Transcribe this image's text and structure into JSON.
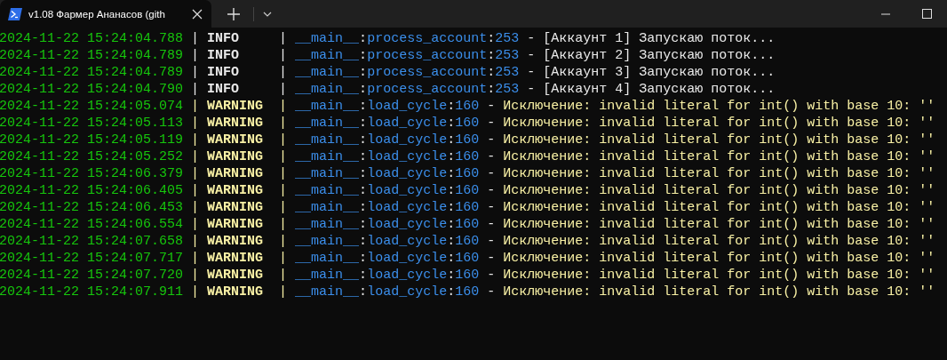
{
  "tabs": [
    {
      "title": "v1.08 Фармер Ананасов (gith",
      "selected": true
    }
  ],
  "lines": [
    {
      "kind": "info",
      "text": "2024-11-22 15:24:04.788 | INFO     | __main__:process_account:253 - [Аккаунт 1] Запускаю поток..."
    },
    {
      "kind": "info",
      "text": "2024-11-22 15:24:04.789 | INFO     | __main__:process_account:253 - [Аккаунт 2] Запускаю поток..."
    },
    {
      "kind": "info",
      "text": "2024-11-22 15:24:04.789 | INFO     | __main__:process_account:253 - [Аккаунт 3] Запускаю поток..."
    },
    {
      "kind": "info",
      "text": "2024-11-22 15:24:04.790 | INFO     | __main__:process_account:253 - [Аккаунт 4] Запускаю поток..."
    },
    {
      "kind": "warning",
      "text": "2024-11-22 15:24:05.074 | WARNING  | __main__:load_cycle:160 - Исключение: invalid literal for int() with base 10: ''"
    },
    {
      "kind": "warning",
      "text": "2024-11-22 15:24:05.113 | WARNING  | __main__:load_cycle:160 - Исключение: invalid literal for int() with base 10: ''"
    },
    {
      "kind": "warning",
      "text": "2024-11-22 15:24:05.119 | WARNING  | __main__:load_cycle:160 - Исключение: invalid literal for int() with base 10: ''"
    },
    {
      "kind": "warning",
      "text": "2024-11-22 15:24:05.252 | WARNING  | __main__:load_cycle:160 - Исключение: invalid literal for int() with base 10: ''"
    },
    {
      "kind": "warning",
      "text": "2024-11-22 15:24:06.379 | WARNING  | __main__:load_cycle:160 - Исключение: invalid literal for int() with base 10: ''"
    },
    {
      "kind": "warning",
      "text": "2024-11-22 15:24:06.405 | WARNING  | __main__:load_cycle:160 - Исключение: invalid literal for int() with base 10: ''"
    },
    {
      "kind": "warning",
      "text": "2024-11-22 15:24:06.453 | WARNING  | __main__:load_cycle:160 - Исключение: invalid literal for int() with base 10: ''"
    },
    {
      "kind": "warning",
      "text": "2024-11-22 15:24:06.554 | WARNING  | __main__:load_cycle:160 - Исключение: invalid literal for int() with base 10: ''"
    },
    {
      "kind": "warning",
      "text": "2024-11-22 15:24:07.658 | WARNING  | __main__:load_cycle:160 - Исключение: invalid literal for int() with base 10: ''"
    },
    {
      "kind": "warning",
      "text": "2024-11-22 15:24:07.717 | WARNING  | __main__:load_cycle:160 - Исключение: invalid literal for int() with base 10: ''"
    },
    {
      "kind": "warning",
      "text": "2024-11-22 15:24:07.720 | WARNING  | __main__:load_cycle:160 - Исключение: invalid literal for int() with base 10: ''"
    },
    {
      "kind": "warning",
      "text": "2024-11-22 15:24:07.911 | WARNING  | __main__:load_cycle:160 - Исключение: invalid literal for int() with base 10: ''"
    }
  ]
}
